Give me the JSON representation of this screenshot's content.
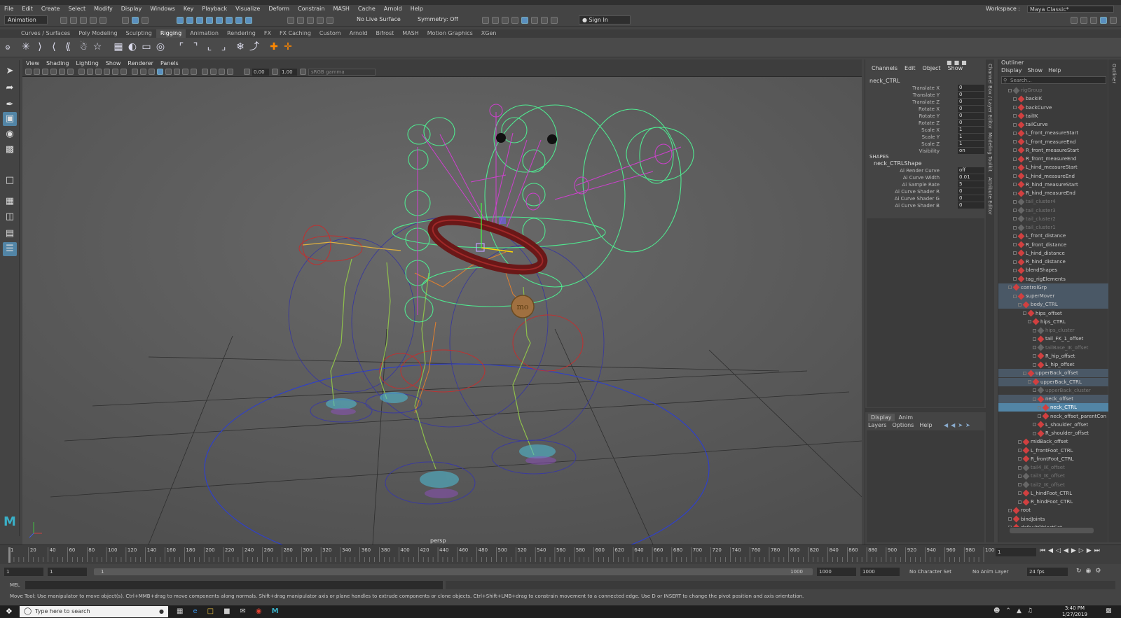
{
  "menu": [
    "File",
    "Edit",
    "Create",
    "Select",
    "Modify",
    "Display",
    "Windows",
    "Key",
    "Playback",
    "Visualize",
    "Deform",
    "Constrain",
    "MASH",
    "Cache",
    "Arnold",
    "Help"
  ],
  "workspace": {
    "label": "Workspace :",
    "value": "Maya Classic*"
  },
  "status": {
    "mode": "Animation",
    "live": "No Live Surface",
    "symmetry": "Symmetry: Off",
    "signin": "Sign In"
  },
  "shelf_tabs": [
    "Curves / Surfaces",
    "Poly Modeling",
    "Sculpting",
    "Rigging",
    "Animation",
    "Rendering",
    "FX",
    "FX Caching",
    "Custom",
    "Arnold",
    "Bifrost",
    "MASH",
    "Motion Graphics",
    "XGen"
  ],
  "shelf_active": "Rigging",
  "viewport": {
    "menu": [
      "View",
      "Shading",
      "Lighting",
      "Show",
      "Renderer",
      "Panels"
    ],
    "exposure": "0.00",
    "gamma": "1.00",
    "colorspace": "sRGB gamma",
    "camera": "persp",
    "collar_tag": "mo"
  },
  "channel_box": {
    "menu": [
      "Channels",
      "Edit",
      "Object",
      "Show"
    ],
    "object": "neck_CTRL",
    "attrs": [
      {
        "label": "Translate X",
        "value": "0"
      },
      {
        "label": "Translate Y",
        "value": "0"
      },
      {
        "label": "Translate Z",
        "value": "0"
      },
      {
        "label": "Rotate X",
        "value": "0"
      },
      {
        "label": "Rotate Y",
        "value": "0"
      },
      {
        "label": "Rotate Z",
        "value": "0"
      },
      {
        "label": "Scale X",
        "value": "1"
      },
      {
        "label": "Scale Y",
        "value": "1"
      },
      {
        "label": "Scale Z",
        "value": "1"
      },
      {
        "label": "Visibility",
        "value": "on"
      }
    ],
    "shapes_header": "SHAPES",
    "shape": "neck_CTRLShape",
    "shape_attrs": [
      {
        "label": "Ai Render Curve",
        "value": "off"
      },
      {
        "label": "Ai Curve Width",
        "value": "0.01"
      },
      {
        "label": "Ai Sample Rate",
        "value": "5"
      },
      {
        "label": "Ai Curve Shader R",
        "value": "0"
      },
      {
        "label": "Ai Curve Shader G",
        "value": "0"
      },
      {
        "label": "Ai Curve Shader B",
        "value": "0"
      }
    ],
    "layer_tabs": [
      "Display",
      "Anim"
    ],
    "layer_menu": [
      "Layers",
      "Options",
      "Help"
    ]
  },
  "side_tabs": [
    "Channel Box / Layer Editor",
    "Modeling Toolkit",
    "Attribute Editor"
  ],
  "outliner": {
    "title": "Outliner",
    "menu": [
      "Display",
      "Show",
      "Help"
    ],
    "search": "Search...",
    "items": [
      {
        "label": "rigGroup",
        "indent": 0,
        "state": "dim"
      },
      {
        "label": "backIK",
        "indent": 1,
        "state": ""
      },
      {
        "label": "backCurve",
        "indent": 1,
        "state": ""
      },
      {
        "label": "tailIK",
        "indent": 1,
        "state": ""
      },
      {
        "label": "tailCurve",
        "indent": 1,
        "state": ""
      },
      {
        "label": "L_front_measureStart",
        "indent": 1,
        "state": ""
      },
      {
        "label": "L_front_measureEnd",
        "indent": 1,
        "state": ""
      },
      {
        "label": "R_front_measureStart",
        "indent": 1,
        "state": ""
      },
      {
        "label": "R_front_measureEnd",
        "indent": 1,
        "state": ""
      },
      {
        "label": "L_hind_measureStart",
        "indent": 1,
        "state": ""
      },
      {
        "label": "L_hind_measureEnd",
        "indent": 1,
        "state": ""
      },
      {
        "label": "R_hind_measureStart",
        "indent": 1,
        "state": ""
      },
      {
        "label": "R_hind_measureEnd",
        "indent": 1,
        "state": ""
      },
      {
        "label": "tail_cluster4",
        "indent": 1,
        "state": "dim"
      },
      {
        "label": "tail_cluster3",
        "indent": 1,
        "state": "dim"
      },
      {
        "label": "tail_cluster2",
        "indent": 1,
        "state": "dim"
      },
      {
        "label": "tail_cluster1",
        "indent": 1,
        "state": "dim"
      },
      {
        "label": "L_front_distance",
        "indent": 1,
        "state": ""
      },
      {
        "label": "R_front_distance",
        "indent": 1,
        "state": ""
      },
      {
        "label": "L_hind_distance",
        "indent": 1,
        "state": ""
      },
      {
        "label": "R_hind_distance",
        "indent": 1,
        "state": ""
      },
      {
        "label": "blendShapes",
        "indent": 1,
        "state": ""
      },
      {
        "label": "tag_rigElements",
        "indent": 1,
        "state": ""
      },
      {
        "label": "controlGrp",
        "indent": 0,
        "state": "hl"
      },
      {
        "label": "superMover",
        "indent": 1,
        "state": "hl"
      },
      {
        "label": "body_CTRL",
        "indent": 2,
        "state": "hl"
      },
      {
        "label": "hips_offset",
        "indent": 3,
        "state": ""
      },
      {
        "label": "hips_CTRL",
        "indent": 4,
        "state": ""
      },
      {
        "label": "hips_cluster",
        "indent": 5,
        "state": "dim"
      },
      {
        "label": "tail_FK_1_offset",
        "indent": 5,
        "state": ""
      },
      {
        "label": "tailBase_IK_offset",
        "indent": 5,
        "state": "dim"
      },
      {
        "label": "R_hip_offset",
        "indent": 5,
        "state": ""
      },
      {
        "label": "L_hip_offset",
        "indent": 5,
        "state": ""
      },
      {
        "label": "upperBack_offset",
        "indent": 3,
        "state": "hl"
      },
      {
        "label": "upperBack_CTRL",
        "indent": 4,
        "state": "hl"
      },
      {
        "label": "upperBack_cluster",
        "indent": 5,
        "state": "dim"
      },
      {
        "label": "neck_offset",
        "indent": 5,
        "state": "hl"
      },
      {
        "label": "neck_CTRL",
        "indent": 6,
        "state": "sel"
      },
      {
        "label": "neck_offset_parentCon",
        "indent": 6,
        "state": ""
      },
      {
        "label": "L_shoulder_offset",
        "indent": 5,
        "state": ""
      },
      {
        "label": "R_shoulder_offset",
        "indent": 5,
        "state": ""
      },
      {
        "label": "midBack_offset",
        "indent": 2,
        "state": ""
      },
      {
        "label": "L_frontFoot_CTRL",
        "indent": 2,
        "state": ""
      },
      {
        "label": "R_frontFoot_CTRL",
        "indent": 2,
        "state": ""
      },
      {
        "label": "tail4_IK_offset",
        "indent": 2,
        "state": "dim"
      },
      {
        "label": "tail3_IK_offset",
        "indent": 2,
        "state": "dim"
      },
      {
        "label": "tail2_IK_offset",
        "indent": 2,
        "state": "dim"
      },
      {
        "label": "L_hindFoot_CTRL",
        "indent": 2,
        "state": ""
      },
      {
        "label": "R_hindFoot_CTRL",
        "indent": 2,
        "state": ""
      },
      {
        "label": "root",
        "indent": 0,
        "state": ""
      },
      {
        "label": "bindJoints",
        "indent": 0,
        "state": ""
      },
      {
        "label": "defaultObjectSet",
        "indent": 0,
        "state": ""
      }
    ]
  },
  "right_tabs": [
    "Outliner"
  ],
  "timeline": {
    "ticks": [
      "1",
      "20",
      "40",
      "60",
      "80",
      "100",
      "120",
      "140",
      "160",
      "180",
      "200",
      "220",
      "240",
      "260",
      "280",
      "300",
      "320",
      "340",
      "360",
      "380",
      "400",
      "420",
      "440",
      "460",
      "480",
      "500",
      "520",
      "540",
      "560",
      "580",
      "600",
      "620",
      "640",
      "660",
      "680",
      "700",
      "720",
      "740",
      "760",
      "780",
      "800",
      "820",
      "840",
      "860",
      "880",
      "900",
      "920",
      "940",
      "960",
      "980",
      "1000"
    ],
    "current": "1"
  },
  "range": {
    "start": "1",
    "start2": "1",
    "slider_start": "1",
    "slider_end": "1000",
    "end": "1000",
    "end2": "1000",
    "charset": "No Character Set",
    "animlayer": "No Anim Layer",
    "fps": "24 fps"
  },
  "cmd": {
    "label": "MEL"
  },
  "help": "Move Tool: Use manipulator to move object(s). Ctrl+MMB+drag to move components along normals. Shift+drag manipulator axis or plane handles to extrude components or clone objects. Ctrl+Shift+LMB+drag to constrain movement to a connected edge. Use D or INSERT to change the pivot position and axis orientation.",
  "taskbar": {
    "search": "Type here to search",
    "time": "3:40 PM",
    "date": "1/27/2019"
  }
}
